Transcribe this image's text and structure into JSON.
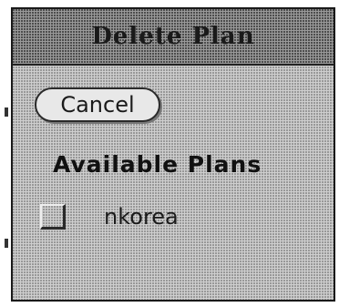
{
  "dialog": {
    "title": "Delete Plan",
    "cancel_label": "Cancel",
    "section_heading": "Available Plans",
    "plans": [
      {
        "name": "nkorea",
        "checked": false
      }
    ]
  },
  "colors": {
    "pane_gray": "#cfcfcf",
    "title_gray": "#9a9a9a",
    "text": "#1a1a1a"
  }
}
